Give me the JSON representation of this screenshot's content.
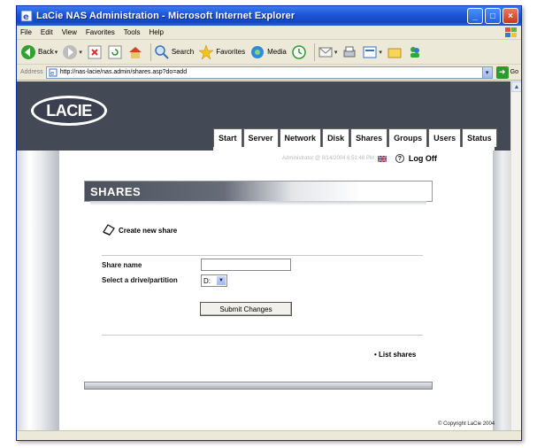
{
  "window": {
    "title": "LaCie NAS Administration - Microsoft Internet Explorer",
    "controls": [
      "_",
      "□",
      "×"
    ]
  },
  "menubar": {
    "items": [
      "File",
      "Edit",
      "View",
      "Favorites",
      "Tools",
      "Help"
    ]
  },
  "toolbar": {
    "back": "Back",
    "search": "Search",
    "favorites": "Favorites",
    "media": "Media"
  },
  "address": {
    "label": "Address",
    "url": "http://nas-lacie/nas.admin/shares.asp?do=add",
    "go": "Go"
  },
  "page": {
    "logo": "LACIE",
    "tabs": [
      "Start",
      "Server",
      "Network",
      "Disk",
      "Shares",
      "Groups",
      "Users",
      "Status"
    ],
    "admin_status": "Administrator @ 8/14/2004 6:51:48 PM",
    "help": "?",
    "logoff": "Log Off",
    "section_title": "SHARES",
    "create_label": "Create new share",
    "share_name_label": "Share name",
    "share_name_value": "",
    "drive_label": "Select a drive/partition",
    "drive_value": "D:",
    "submit_label": "Submit Changes",
    "list_shares": "• List shares",
    "copyright": "© Copyright LaCie 2004"
  },
  "colors": {
    "titlebar": "#1b55d6",
    "header_band": "#444a55",
    "chrome": "#ece9d8"
  }
}
